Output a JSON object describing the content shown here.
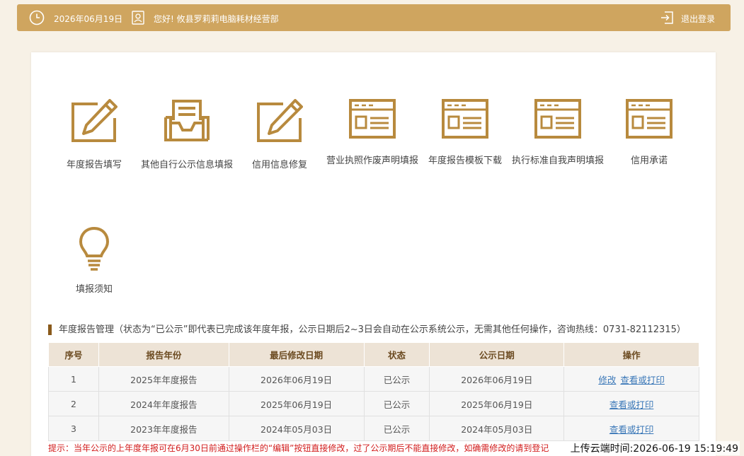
{
  "header": {
    "date": "2026年06月19日",
    "greeting": "您好! 攸县罗莉莉电脑耗材经营部",
    "logout": "退出登录"
  },
  "tiles": [
    {
      "label": "年度报告填写",
      "icon": "edit-pen-icon"
    },
    {
      "label": "其他自行公示信息填报",
      "icon": "inbox-tray-icon"
    },
    {
      "label": "信用信息修复",
      "icon": "edit-pen-icon"
    },
    {
      "label": "营业执照作废声明填报",
      "icon": "form-window-icon"
    },
    {
      "label": "年度报告模板下载",
      "icon": "form-window-icon"
    },
    {
      "label": "执行标准自我声明填报",
      "icon": "form-window-icon"
    },
    {
      "label": "信用承诺",
      "icon": "form-window-icon"
    },
    {
      "label": "填报须知",
      "icon": "lightbulb-icon"
    }
  ],
  "section": {
    "title": "年度报告管理（状态为“已公示”即代表已完成该年度年报，公示日期后2~3日会自动在公示系统公示，无需其他任何操作，咨询热线：0731-82112315）"
  },
  "table": {
    "headers": [
      "序号",
      "报告年份",
      "最后修改日期",
      "状态",
      "公示日期",
      "操作"
    ],
    "rows": [
      {
        "no": "1",
        "year": "2025年年度报告",
        "modified": "2026年06月19日",
        "status": "已公示",
        "published": "2026年06月19日",
        "edit": "修改",
        "view": "查看或打印"
      },
      {
        "no": "2",
        "year": "2024年年度报告",
        "modified": "2025年06月19日",
        "status": "已公示",
        "published": "2025年06月19日",
        "edit": "",
        "view": "查看或打印"
      },
      {
        "no": "3",
        "year": "2023年年度报告",
        "modified": "2024年05月03日",
        "status": "已公示",
        "published": "2024年05月03日",
        "edit": "",
        "view": "查看或打印"
      }
    ]
  },
  "hint": "提示：当年公示的上年度年报可在6月30日前通过操作栏的“编辑”按钮直接修改，过了公示期后不能直接修改，如确需修改的请到登记",
  "timestamp": "上传云端时间:2026-06-19 15:19:49",
  "colors": {
    "accent": "#cfa55f",
    "icon": "#b88a3e",
    "hint": "#d21d1d",
    "link": "#3b78b8"
  }
}
